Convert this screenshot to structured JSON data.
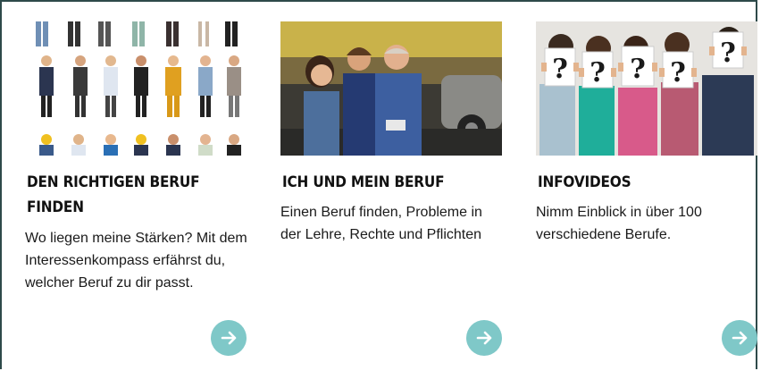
{
  "cards": [
    {
      "title": "DEN RICHTIGEN BERUF FINDEN",
      "description": "Wo liegen meine Stärken? Mit dem Interessenkompass erfährst du, welcher Beruf zu dir passt.",
      "image_icon": "people-occupations-icon",
      "button_icon": "arrow-right-icon"
    },
    {
      "title": "ICH UND MEIN BERUF",
      "description": "Einen Beruf finden, Probleme in der Lehre, Rechte und Pflichten",
      "image_icon": "mechanic-workshop-icon",
      "button_icon": "arrow-right-icon"
    },
    {
      "title": "INFOVIDEOS",
      "description": "Nimm Einblick in über 100 verschiedene Berufe.",
      "image_icon": "question-signs-icon",
      "button_icon": "arrow-right-icon",
      "image_question_marks": [
        "?",
        "?",
        "?",
        "?",
        "?"
      ]
    }
  ],
  "colors": {
    "border": "#2e4a4a",
    "button": "#7fc8c8",
    "text": "#111111"
  }
}
